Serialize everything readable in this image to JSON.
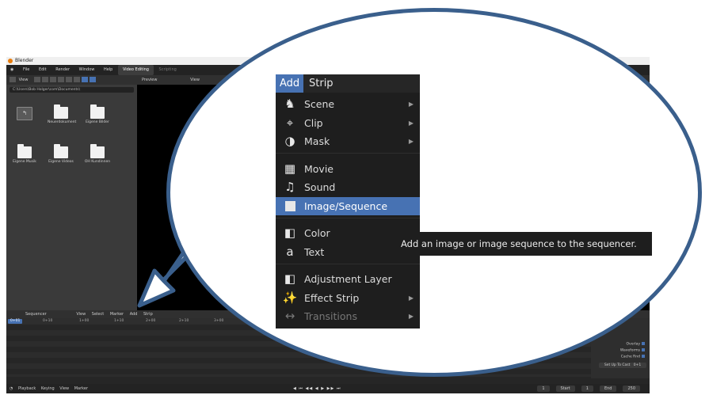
{
  "app": {
    "window_title": "Blender",
    "menus": [
      "File",
      "Edit",
      "Render",
      "Window",
      "Help"
    ],
    "workspaces": [
      "Video Editing",
      "Scripting"
    ],
    "file_browser": {
      "view_label": "View",
      "path": "C:\\Users\\Bob Holger\\com\\Documents\\",
      "folders": [
        "Neuerdokument",
        "Eigene Bilder",
        "Eigene Musik",
        "Eigene Videos",
        "OH Kundinnen"
      ]
    },
    "preview": {
      "label": "Preview",
      "view_label": "View"
    },
    "sequencer": {
      "label": "Sequencer",
      "menus": [
        "View",
        "Select",
        "Marker",
        "Add",
        "Strip"
      ],
      "current_frame": "0+01",
      "ticks": [
        "0+10",
        "1+00",
        "1+10",
        "2+00",
        "2+10",
        "3+00"
      ],
      "side_options": [
        "Overlay",
        "Waveforms",
        "Cache Rnd"
      ],
      "strip_button": "Set Up To Cast",
      "strip_value": "0+1"
    },
    "timeline": {
      "menus": [
        "Playback",
        "Keying",
        "View",
        "Marker"
      ],
      "controls": "◀ ⏮ ◀◀ ◀ ▶ ▶▶ ⏭",
      "fields": [
        "1",
        "Start",
        "1",
        "End",
        "250"
      ]
    }
  },
  "callout": {
    "tabs": {
      "add": "Add",
      "strip": "Strip"
    },
    "menu_items": [
      {
        "label": "Scene",
        "icon": "scene-icon",
        "submenu": true
      },
      {
        "label": "Clip",
        "icon": "clip-icon",
        "submenu": true
      },
      {
        "label": "Mask",
        "icon": "mask-icon",
        "submenu": true
      },
      {
        "label": "Movie",
        "icon": "movie-icon",
        "submenu": false
      },
      {
        "label": "Sound",
        "icon": "sound-icon",
        "submenu": false
      },
      {
        "label": "Image/Sequence",
        "icon": "image-icon",
        "submenu": false,
        "highlighted": true
      },
      {
        "label": "Color",
        "icon": "color-icon",
        "submenu": false
      },
      {
        "label": "Text",
        "icon": "text-icon",
        "submenu": false
      },
      {
        "label": "Adjustment Layer",
        "icon": "adjustment-layer-icon",
        "submenu": false
      },
      {
        "label": "Effect Strip",
        "icon": "effect-strip-icon",
        "submenu": true
      },
      {
        "label": "Transitions",
        "icon": "transitions-icon",
        "submenu": true,
        "disabled": true
      }
    ],
    "tooltip": "Add an image or image sequence to the sequencer.",
    "colors": {
      "highlight": "#4772b3",
      "ellipse_border": "#3a5f8c",
      "menu_bg": "#1e1e1e"
    }
  }
}
